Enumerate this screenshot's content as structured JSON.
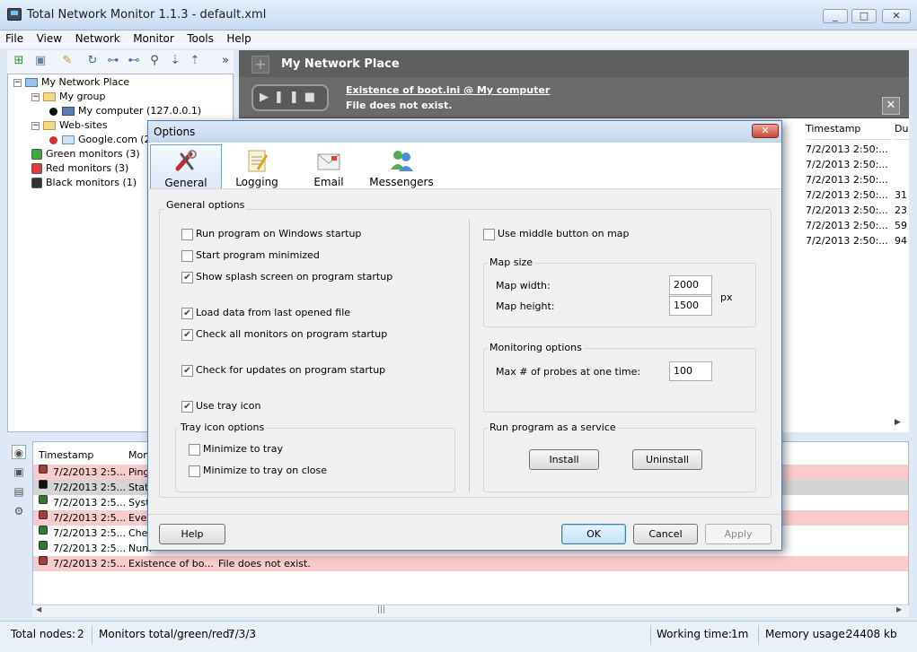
{
  "window": {
    "title": "Total Network Monitor 1.1.3 - default.xml",
    "controls": [
      "_",
      "□",
      "✕"
    ]
  },
  "menu": [
    "File",
    "View",
    "Network",
    "Monitor",
    "Tools",
    "Help"
  ],
  "toolbar_icons": [
    "add-node-icon",
    "add-monitor-icon",
    "edit-icon",
    "refresh-icon",
    "network-icon",
    "network2-icon",
    "search-icon",
    "sort-down-icon",
    "sort-up-icon"
  ],
  "tree": {
    "root": "My Network Place",
    "group": "My group",
    "computer": "My computer (127.0.0.1)",
    "websites": "Web-sites",
    "google": "Google.com (20",
    "green": "Green monitors (3)",
    "red": "Red monitors (3)",
    "black": "Black monitors (1)"
  },
  "right_panel": {
    "header": "My Network Place",
    "banner_link": "Existence of boot.ini @ My computer",
    "banner_msg": "File does not exist.",
    "columns": [
      "Timestamp",
      "Du"
    ],
    "rows": [
      [
        "7/2/2013 2:50:...",
        ""
      ],
      [
        "7/2/2013 2:50:...",
        ""
      ],
      [
        "7/2/2013 2:50:...",
        ""
      ],
      [
        "7/2/2013 2:50:...",
        "31"
      ],
      [
        "7/2/2013 2:50:...",
        "23"
      ],
      [
        "7/2/2013 2:50:...",
        "59"
      ],
      [
        "7/2/2013 2:50:...",
        "94"
      ]
    ]
  },
  "log": {
    "columns": [
      "Timestamp",
      "Mon"
    ],
    "rows": [
      {
        "ts": "7/2/2013 2:5...",
        "mon": "Ping",
        "msg": "",
        "color": "#a33b3b",
        "bg": "#f8cccc"
      },
      {
        "ts": "7/2/2013 2:5...",
        "mon": "Stat",
        "msg": "",
        "color": "#111111",
        "bg": "#d4d4d4"
      },
      {
        "ts": "7/2/2013 2:5...",
        "mon": "Syst",
        "msg": "",
        "color": "#2e7d32",
        "bg": "#ffffff"
      },
      {
        "ts": "7/2/2013 2:5...",
        "mon": "Ever",
        "msg": "",
        "color": "#a33b3b",
        "bg": "#f8cccc"
      },
      {
        "ts": "7/2/2013 2:5...",
        "mon": "Che",
        "msg": "",
        "color": "#2e7d32",
        "bg": "#ffffff"
      },
      {
        "ts": "7/2/2013 2:5...",
        "mon": "Num",
        "msg": "",
        "color": "#2e7d32",
        "bg": "#ffffff"
      },
      {
        "ts": "7/2/2013 2:5...",
        "mon": "Existence of bo...",
        "msg": "File does not exist.",
        "color": "#a33b3b",
        "bg": "#f8cccc"
      }
    ]
  },
  "status": {
    "nodes_label": "Total nodes:",
    "nodes_value": "2",
    "monitors_label": "Monitors total/green/red:",
    "monitors_value": "7/3/3",
    "working_label": "Working time:",
    "working_value": "1m",
    "memory_label": "Memory usage:",
    "memory_value": "24408 kb"
  },
  "dialog": {
    "title": "Options",
    "tabs": [
      "General",
      "Logging",
      "Email",
      "Messengers"
    ],
    "general_group": "General options",
    "options": {
      "run_startup": "Run program on Windows startup",
      "start_minimized": "Start program minimized",
      "splash": "Show splash screen on program startup",
      "load_data": "Load data from last opened file",
      "check_monitors": "Check all monitors on program startup",
      "check_updates": "Check for updates on program startup",
      "tray_icon": "Use tray icon"
    },
    "checked": {
      "run_startup": false,
      "start_minimized": false,
      "splash": true,
      "load_data": true,
      "check_monitors": true,
      "check_updates": true,
      "tray_icon": true,
      "minimize_tray": false,
      "minimize_close": false,
      "middle_button": false
    },
    "tray_group": "Tray icon options",
    "minimize_tray": "Minimize to tray",
    "minimize_close": "Minimize to tray on close",
    "middle_button": "Use middle button on map",
    "map_size": {
      "label": "Map size",
      "width_label": "Map width:",
      "width_value": "2000",
      "height_label": "Map height:",
      "height_value": "1500",
      "unit": "px"
    },
    "monitoring": {
      "label": "Monitoring options",
      "probes_label": "Max # of probes at one time:",
      "probes_value": "100"
    },
    "service": {
      "label": "Run program as a service",
      "install": "Install",
      "uninstall": "Uninstall"
    },
    "buttons": {
      "help": "Help",
      "ok": "OK",
      "cancel": "Cancel",
      "apply": "Apply"
    }
  }
}
